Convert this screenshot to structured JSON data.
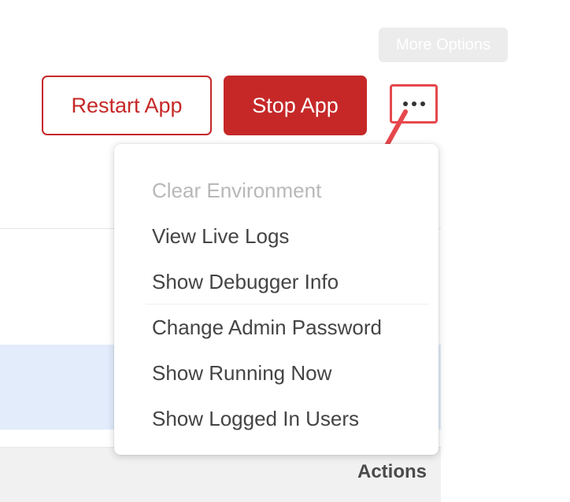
{
  "toolbar": {
    "more_options_label": "More Options",
    "restart_label": "Restart App",
    "stop_label": "Stop App",
    "kebab_icon": "ellipsis-horizontal-icon"
  },
  "menu": {
    "items": [
      {
        "label": "Clear Environment",
        "disabled": true
      },
      {
        "label": "View Live Logs",
        "disabled": false
      },
      {
        "label": "Show Debugger Info",
        "disabled": false
      },
      {
        "label": "Change Admin Password",
        "disabled": false
      },
      {
        "label": "Show Running Now",
        "disabled": false
      },
      {
        "label": "Show Logged In Users",
        "disabled": false
      }
    ]
  },
  "table": {
    "actions_header": "Actions"
  },
  "colors": {
    "brand_red": "#c62828",
    "annotation_red": "#e5484d",
    "selected_row": "#e2ecfb"
  }
}
